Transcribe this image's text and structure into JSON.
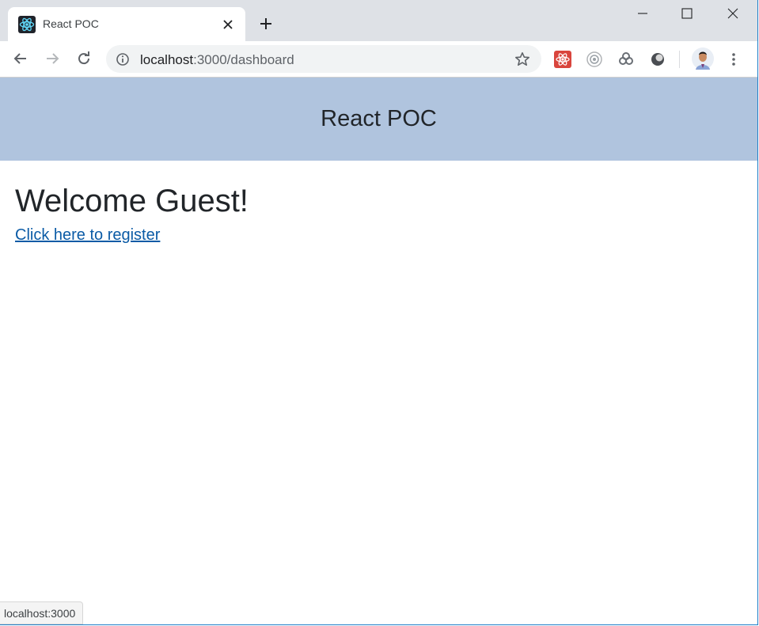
{
  "browser": {
    "tab": {
      "title": "React POC",
      "favicon": "react-atom-icon"
    },
    "url": {
      "host": "localhost",
      "path": ":3000/dashboard"
    },
    "window_controls": [
      "minimize-icon",
      "maximize-icon",
      "close-icon"
    ],
    "toolbar_icons": [
      "back-arrow-icon",
      "forward-arrow-icon",
      "reload-icon",
      "site-info-icon",
      "bookmark-star-icon"
    ],
    "extensions": [
      "react-devtools-icon",
      "target-extension-icon",
      "link-extension-icon",
      "sphere-extension-icon"
    ],
    "profile": "profile-avatar",
    "status_text": "localhost:3000"
  },
  "page": {
    "header_title": "React POC",
    "welcome": "Welcome Guest!",
    "register_link": "Click here to register"
  },
  "colors": {
    "header_bg": "#b0c4de",
    "link": "#0b5ba6",
    "text": "#212529",
    "tabstrip_bg": "#dee1e6"
  }
}
